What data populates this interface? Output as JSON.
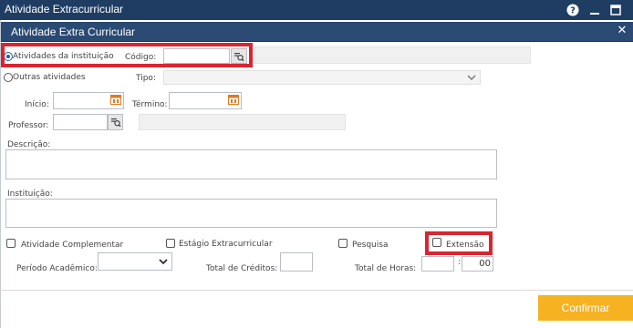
{
  "window": {
    "title": "Atividade Extracurricular",
    "help_icon": "help-icon",
    "minimize_icon": "minimize-icon",
    "maximize_icon": "maximize-icon"
  },
  "dialog": {
    "title": "Atividade Extra Curricular",
    "close_icon": "close-icon"
  },
  "form": {
    "radio_instituicao": "Atividades da instituição",
    "codigo_label": "Código:",
    "codigo_value": "",
    "radio_outras": "Outras atividades",
    "tipo_label": "Tipo:",
    "tipo_value": "",
    "inicio_label": "Início:",
    "inicio_value": "",
    "termino_label": "Término:",
    "termino_value": "",
    "professor_label": "Professor:",
    "professor_value": "",
    "descricao_label": "Descrição:",
    "descricao_value": "",
    "instituicao_label": "Instituição:",
    "instituicao_value": "",
    "cb_complementar": "Atividade Complementar",
    "cb_estagio": "Estágio Extracurricular",
    "cb_pesquisa": "Pesquisa",
    "cb_extensao": "Extensão",
    "periodo_label": "Período Acadêmico:",
    "periodo_value": "",
    "creditos_label": "Total de Créditos:",
    "creditos_value": "",
    "horas_label": "Total de Horas:",
    "horas_value": "",
    "horas_sep": ":",
    "minutos_value": "00"
  },
  "footer": {
    "confirm_label": "Confirmar"
  },
  "colors": {
    "titlebar": "#1f3d63",
    "dialog_header": "#2a4a73",
    "highlight": "#d8252f",
    "confirm": "#f7b221"
  }
}
